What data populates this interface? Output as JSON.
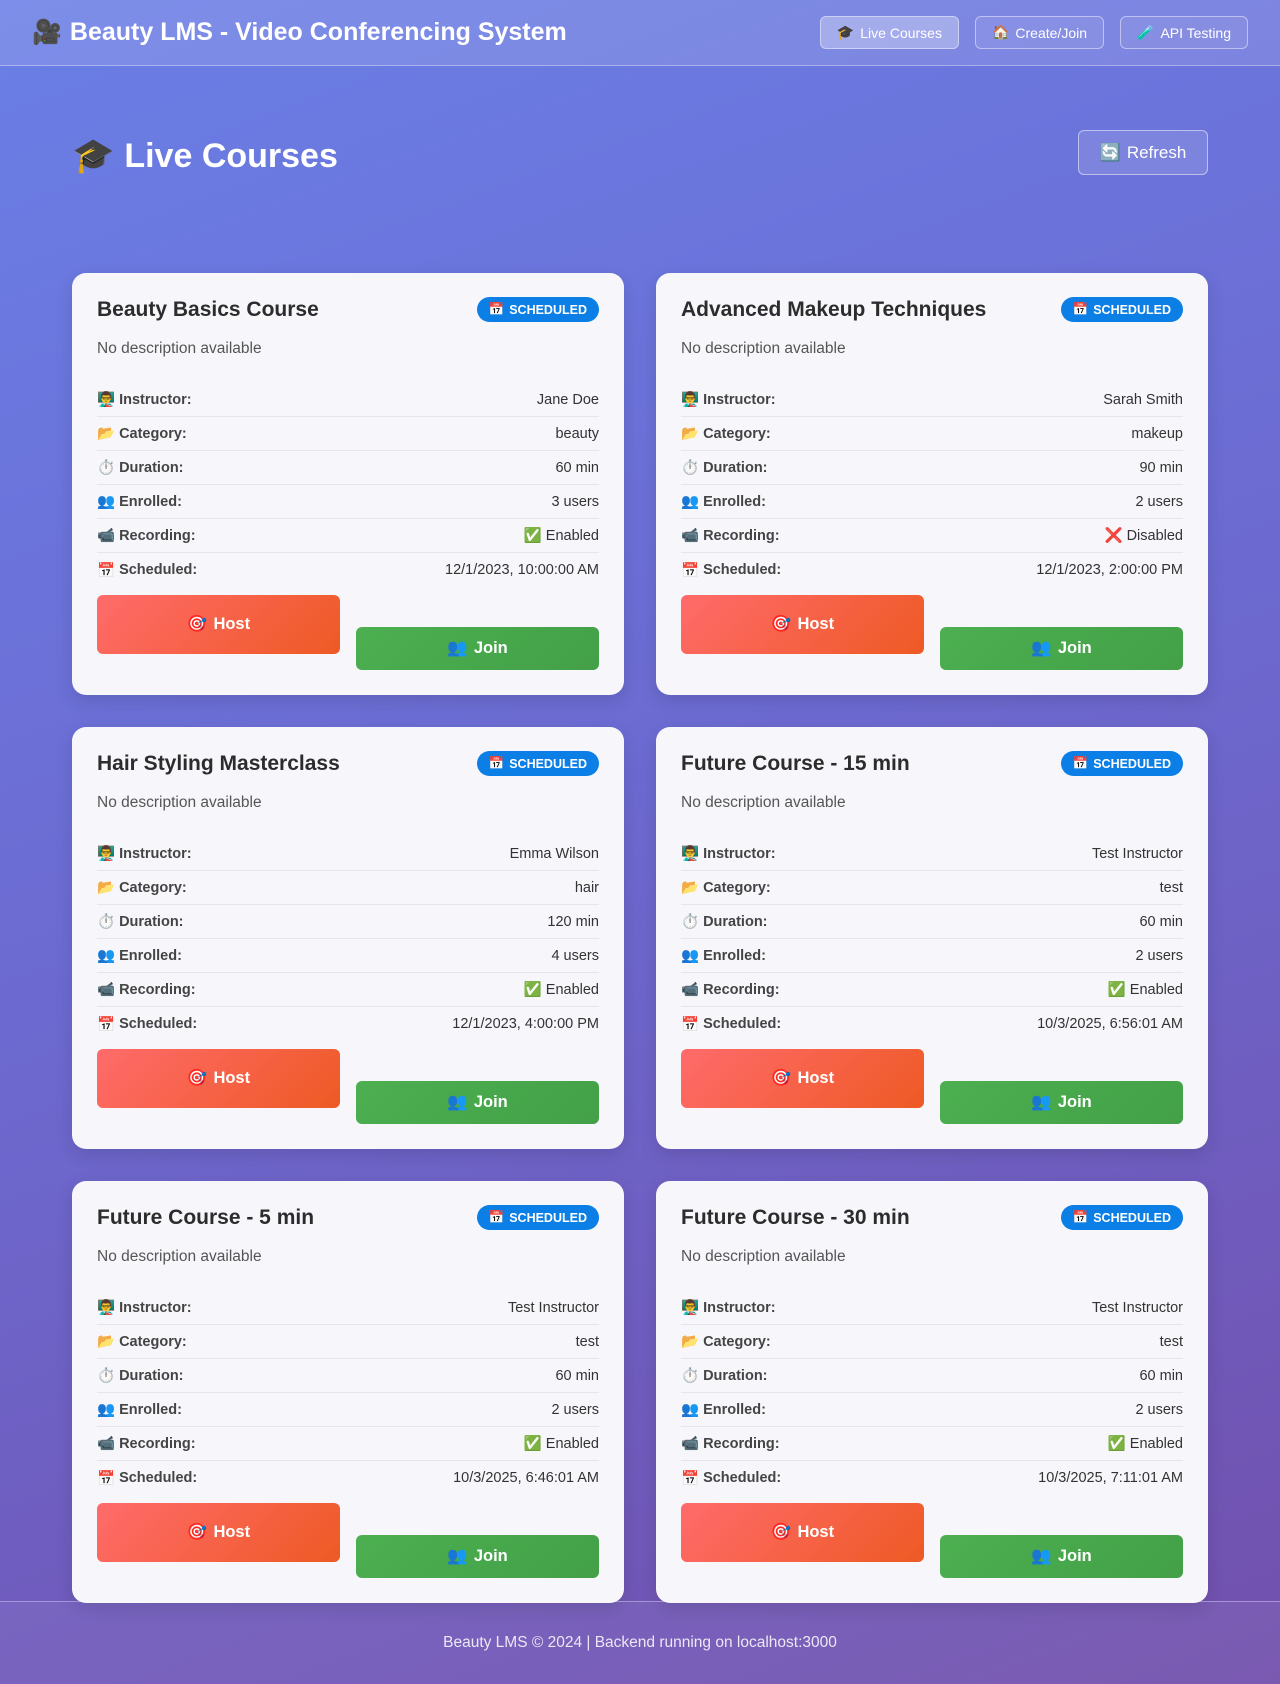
{
  "header": {
    "icon": "🎥",
    "title": "Beauty LMS - Video Conferencing System",
    "nav": [
      {
        "icon": "🎓",
        "label": "Live Courses"
      },
      {
        "icon": "🏠",
        "label": "Create/Join"
      },
      {
        "icon": "🧪",
        "label": "API Testing"
      }
    ]
  },
  "page": {
    "icon": "🎓",
    "title": "Live Courses",
    "refresh_icon": "🔄",
    "refresh_label": "Refresh"
  },
  "labels": {
    "instructor": "Instructor:",
    "category": "Category:",
    "duration": "Duration:",
    "enrolled": "Enrolled:",
    "recording": "Recording:",
    "scheduled": "Scheduled:",
    "host": "Host",
    "join": "Join",
    "badge": "SCHEDULED"
  },
  "icons": {
    "instructor": "👨‍🏫",
    "category": "📂",
    "duration": "⏱️",
    "enrolled": "👥",
    "recording": "📹",
    "scheduled": "📅",
    "host": "🎯",
    "join": "👥",
    "badge": "📅"
  },
  "courses": [
    {
      "title": "Beauty Basics Course",
      "description": "No description available",
      "instructor": "Jane Doe",
      "category": "beauty",
      "duration": "60 min",
      "enrolled": "3 users",
      "recording": "✅ Enabled",
      "scheduled": "12/1/2023, 10:00:00 AM"
    },
    {
      "title": "Advanced Makeup Techniques",
      "description": "No description available",
      "instructor": "Sarah Smith",
      "category": "makeup",
      "duration": "90 min",
      "enrolled": "2 users",
      "recording": "❌ Disabled",
      "scheduled": "12/1/2023, 2:00:00 PM"
    },
    {
      "title": "Hair Styling Masterclass",
      "description": "No description available",
      "instructor": "Emma Wilson",
      "category": "hair",
      "duration": "120 min",
      "enrolled": "4 users",
      "recording": "✅ Enabled",
      "scheduled": "12/1/2023, 4:00:00 PM"
    },
    {
      "title": "Future Course - 15 min",
      "description": "No description available",
      "instructor": "Test Instructor",
      "category": "test",
      "duration": "60 min",
      "enrolled": "2 users",
      "recording": "✅ Enabled",
      "scheduled": "10/3/2025, 6:56:01 AM"
    },
    {
      "title": "Future Course - 5 min",
      "description": "No description available",
      "instructor": "Test Instructor",
      "category": "test",
      "duration": "60 min",
      "enrolled": "2 users",
      "recording": "✅ Enabled",
      "scheduled": "10/3/2025, 6:46:01 AM"
    },
    {
      "title": "Future Course - 30 min",
      "description": "No description available",
      "instructor": "Test Instructor",
      "category": "test",
      "duration": "60 min",
      "enrolled": "2 users",
      "recording": "✅ Enabled",
      "scheduled": "10/3/2025, 7:11:01 AM"
    }
  ],
  "footer": {
    "text": "Beauty LMS © 2024 | Backend running on localhost:3000"
  },
  "colors": {
    "badge": "#0b7fe6",
    "host_start": "#ff6b6b",
    "host_end": "#ee5a24",
    "join": "#4caf50"
  }
}
